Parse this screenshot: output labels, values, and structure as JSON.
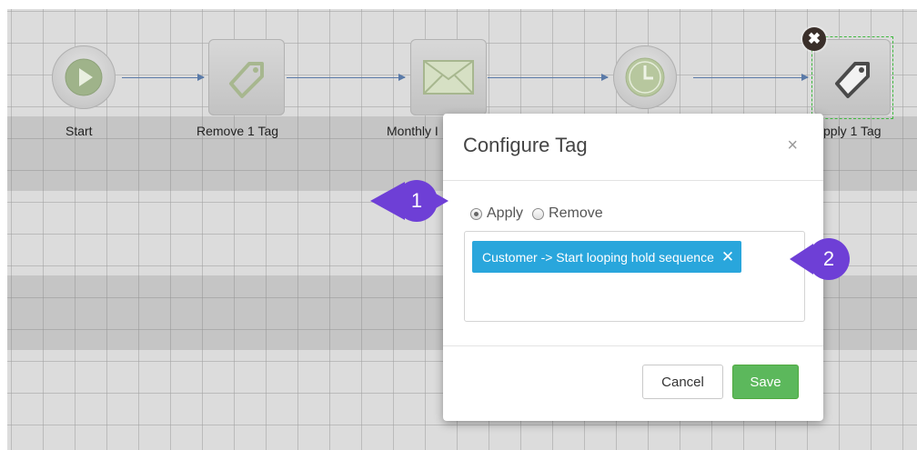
{
  "workflow": {
    "nodes": [
      {
        "label": "Start",
        "icon": "play-icon"
      },
      {
        "label": "Remove 1 Tag",
        "icon": "tag-icon"
      },
      {
        "label": "Monthly I",
        "icon": "envelope-icon"
      },
      {
        "label": "",
        "icon": "clock-icon"
      },
      {
        "label": "pply 1 Tag",
        "icon": "tag-icon"
      }
    ],
    "delete_badge": "✖"
  },
  "modal": {
    "title": "Configure Tag",
    "close": "×",
    "radio_apply": "Apply",
    "radio_remove": "Remove",
    "selected_mode": "Apply",
    "tag_chip": "Customer -> Start looping hold sequence",
    "tag_chip_remove": "✕",
    "cancel": "Cancel",
    "save": "Save"
  },
  "callouts": {
    "one": "1",
    "two": "2"
  },
  "colors": {
    "chip": "#29a6dc",
    "save": "#5cb85c",
    "callout": "#6e3fd6",
    "connector": "#5a7aa8",
    "selection": "#3db83d"
  }
}
